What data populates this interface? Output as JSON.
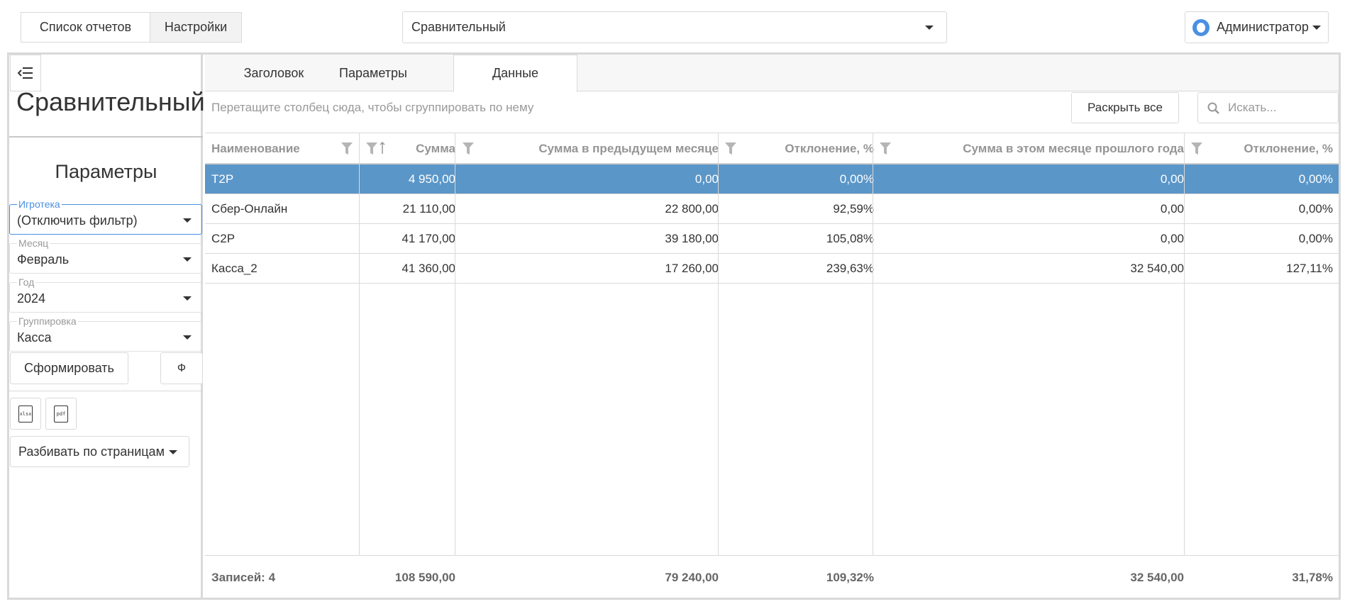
{
  "topbar": {
    "reports_list": "Список отчетов",
    "settings": "Настройки",
    "selected_report": "Сравнительный",
    "user": "Администратор"
  },
  "left": {
    "report_title": "Сравнительный",
    "params_title": "Параметры",
    "fields": [
      {
        "label": "Игротека",
        "value": "(Отключить фильтр)"
      },
      {
        "label": "Месяц",
        "value": "Февраль"
      },
      {
        "label": "Год",
        "value": "2024"
      },
      {
        "label": "Группировка",
        "value": "Касса"
      }
    ],
    "generate_button": "Сформировать",
    "f_button": "Ф",
    "xlsx_label": "xlsx",
    "pdf_label": "pdf",
    "paging_select": "Разбивать по страницам"
  },
  "tabs": [
    {
      "label": "Заголовок"
    },
    {
      "label": "Параметры"
    },
    {
      "label": "Данные"
    }
  ],
  "toolbar": {
    "group_hint": "Перетащите столбец сюда, чтобы сгруппировать по нему",
    "expand_all": "Раскрыть все",
    "search_placeholder": "Искать..."
  },
  "grid": {
    "columns": [
      "Наименование",
      "Сумма",
      "Сумма в предыдущем месяце",
      "Отклонение, %",
      "Сумма в этом месяце прошлого года",
      "Отклонение, %"
    ],
    "rows": [
      [
        "T2P",
        "4 950,00",
        "0,00",
        "0,00%",
        "0,00",
        "0,00%"
      ],
      [
        "Сбер-Онлайн",
        "21 110,00",
        "22 800,00",
        "92,59%",
        "0,00",
        "0,00%"
      ],
      [
        "C2P",
        "41 170,00",
        "39 180,00",
        "105,08%",
        "0,00",
        "0,00%"
      ],
      [
        "Касса_2",
        "41 360,00",
        "17 260,00",
        "239,63%",
        "32 540,00",
        "127,11%"
      ]
    ],
    "selected_row": 0,
    "footer": [
      "Записей: 4",
      "108 590,00",
      "79 240,00",
      "109,32%",
      "32 540,00",
      "31,78%"
    ]
  },
  "colors": {
    "selection": "#5b96c8",
    "accent": "#4a90e2"
  }
}
